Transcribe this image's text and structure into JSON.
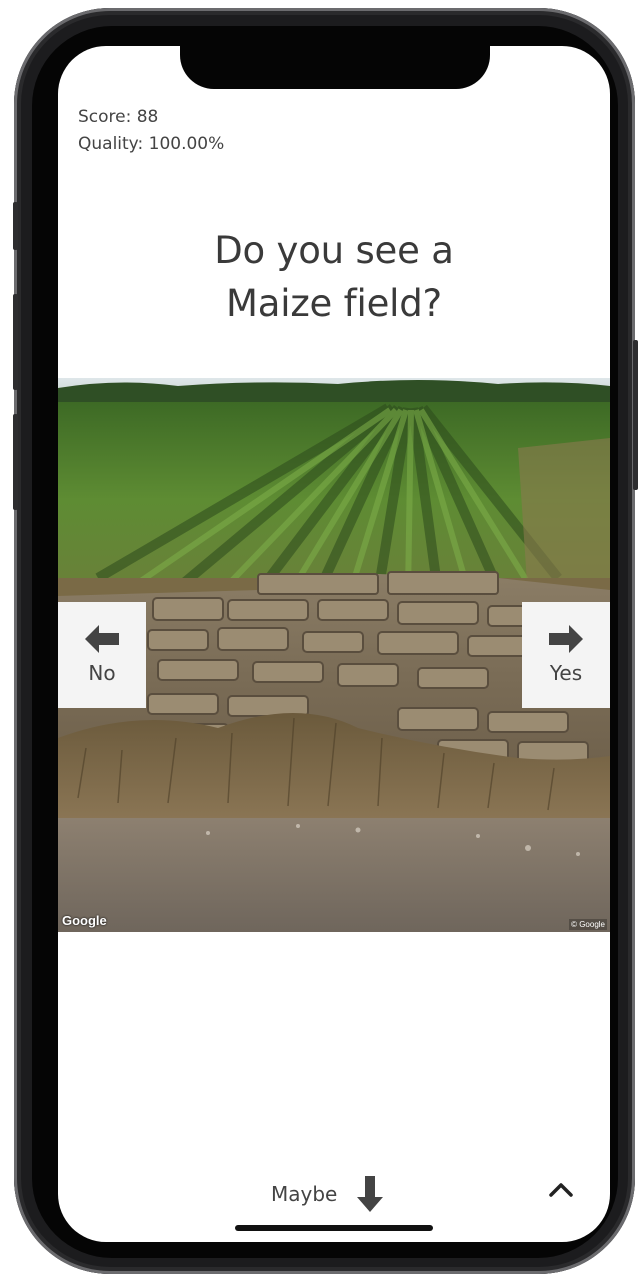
{
  "stats": {
    "score": "Score: 88",
    "quality": "Quality: 100.00%"
  },
  "question": {
    "line1": "Do you see a",
    "line2": "Maize field?"
  },
  "photo": {
    "attribution_logo": "Google",
    "copyright": "© Google"
  },
  "buttons": {
    "no_label": "No",
    "yes_label": "Yes",
    "maybe_label": "Maybe"
  },
  "icons": {
    "no": "arrow-left-icon",
    "yes": "arrow-right-icon",
    "maybe": "arrow-down-icon",
    "expand": "chevron-up-icon"
  },
  "colors": {
    "button_bg": "#f4f4f4",
    "text": "#444444",
    "icon": "#444444"
  }
}
